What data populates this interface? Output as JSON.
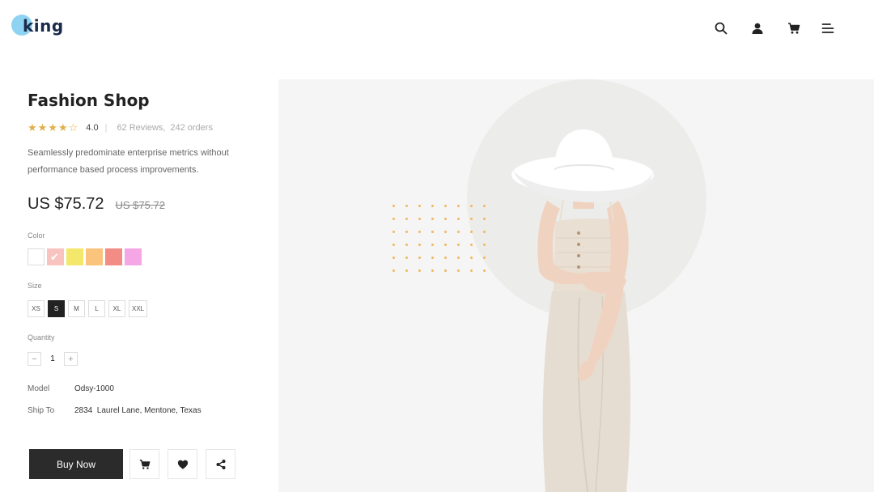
{
  "header": {
    "logo_text": "king",
    "icons": [
      "search-icon",
      "user-icon",
      "cart-icon",
      "menu-icon"
    ]
  },
  "product": {
    "title": "Fashion Shop",
    "rating": "4.0",
    "stars_filled": 4,
    "stars_total": 5,
    "reviews": "62 Reviews,",
    "orders": "242 orders",
    "description": "Seamlessly predominate enterprise metrics without performance based process improvements.",
    "price": "US $75.72",
    "old_price": "US $75.72"
  },
  "color": {
    "label": "Color",
    "options": [
      "#ffffff",
      "#f9c3c0",
      "#f3e86a",
      "#fbc47c",
      "#f48c86",
      "#f4a7e4"
    ],
    "selected_index": 1
  },
  "size": {
    "label": "Size",
    "options": [
      "XS",
      "S",
      "M",
      "L",
      "XL",
      "XXL"
    ],
    "selected": "S"
  },
  "quantity": {
    "label": "Quantity",
    "minus": "−",
    "value": "1",
    "plus": "+"
  },
  "details": {
    "model_label": "Model",
    "model_value": "Odsy-1000",
    "ship_label": "Ship To",
    "ship_value": "2834  Laurel Lane, Mentone, Texas"
  },
  "actions": {
    "buy_now": "Buy Now",
    "icons": [
      "cart-icon",
      "heart-icon",
      "share-icon"
    ]
  },
  "colors": {
    "accent_dark": "#2b2b2b",
    "star": "#e0b04a",
    "dots": "#f0b860",
    "hero_bg": "#f5f5f5"
  }
}
